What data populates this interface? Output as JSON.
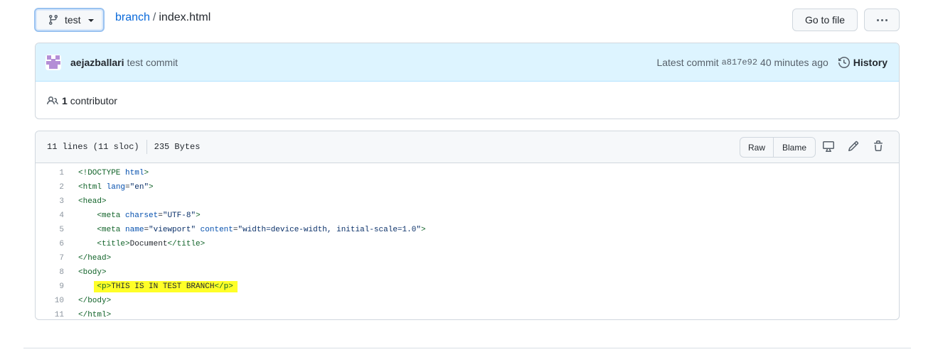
{
  "header": {
    "branch_name": "test",
    "breadcrumb_link": "branch",
    "breadcrumb_sep": "/",
    "file_name": "index.html",
    "goto_label": "Go to file"
  },
  "commit": {
    "author": "aejazballari",
    "message": "test commit",
    "latest_label": "Latest commit",
    "sha": "a817e92",
    "time": "40 minutes ago",
    "history_label": "History",
    "contributor_count": "1",
    "contributor_label": "contributor"
  },
  "file": {
    "lines_info": "11 lines (11 sloc)",
    "size": "235 Bytes",
    "raw_label": "Raw",
    "blame_label": "Blame"
  },
  "code_lines": [
    {
      "n": "1",
      "text": "<!DOCTYPE html>"
    },
    {
      "n": "2",
      "text": "<html lang=\"en\">"
    },
    {
      "n": "3",
      "text": "<head>"
    },
    {
      "n": "4",
      "text": "    <meta charset=\"UTF-8\">"
    },
    {
      "n": "5",
      "text": "    <meta name=\"viewport\" content=\"width=device-width, initial-scale=1.0\">"
    },
    {
      "n": "6",
      "text": "    <title>Document</title>"
    },
    {
      "n": "7",
      "text": "</head>"
    },
    {
      "n": "8",
      "text": "<body>"
    },
    {
      "n": "9",
      "text": "    <p>THIS IS IN TEST BRANCH</p>",
      "highlight": true
    },
    {
      "n": "10",
      "text": "</body>"
    },
    {
      "n": "11",
      "text": "</html>"
    }
  ],
  "colors": {
    "link": "#0969da",
    "commit_bg": "#ddf4ff",
    "highlight": "#ffff28"
  }
}
